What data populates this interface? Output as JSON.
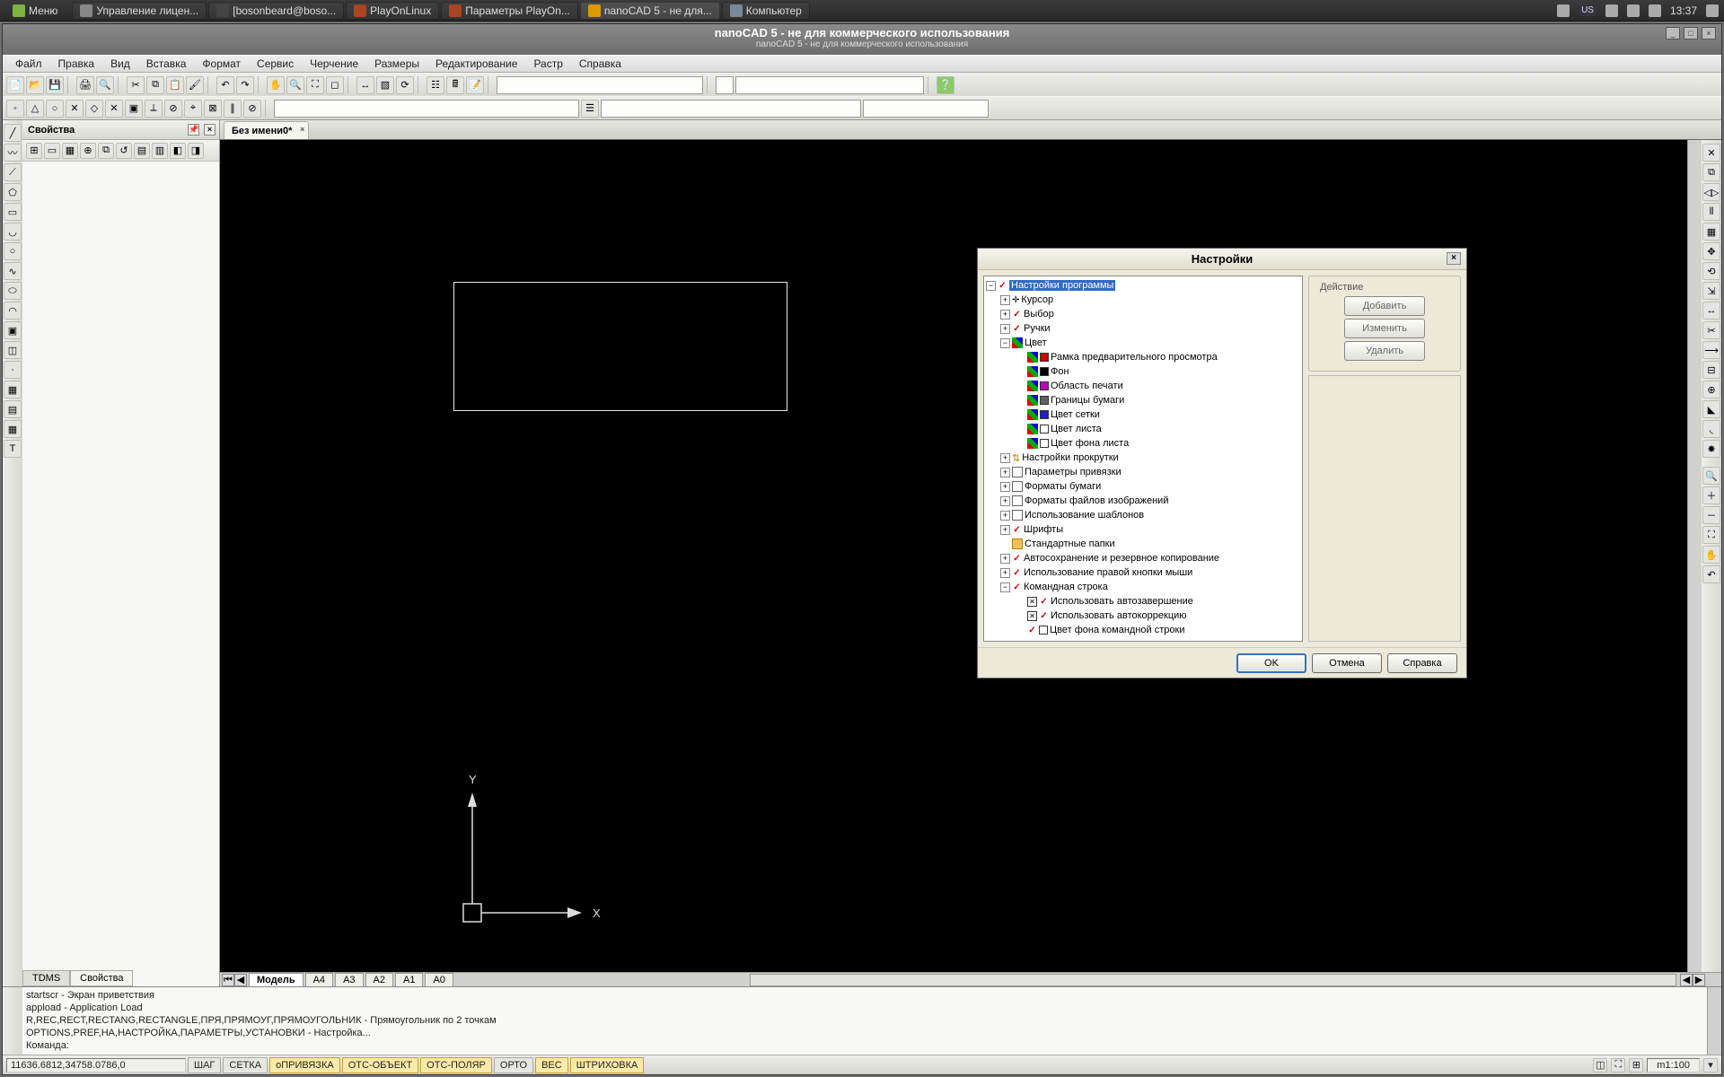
{
  "os": {
    "menu": "Меню",
    "tasks": [
      {
        "label": "Управление лицен..."
      },
      {
        "label": "[bosonbeard@boso..."
      },
      {
        "label": "PlayOnLinux"
      },
      {
        "label": "Параметры PlayOn..."
      },
      {
        "label": "nanoCAD 5 - не для...",
        "active": true
      },
      {
        "label": "Компьютер"
      }
    ],
    "lang": "US",
    "time": "13:37"
  },
  "window": {
    "title": "nanoCAD 5 - не для коммерческого использования",
    "subtitle": "nanoCAD 5 - не для коммерческого использования"
  },
  "menu": [
    "Файл",
    "Правка",
    "Вид",
    "Вставка",
    "Формат",
    "Сервис",
    "Черчение",
    "Размеры",
    "Редактирование",
    "Растр",
    "Справка"
  ],
  "properties_panel": {
    "title": "Свойства"
  },
  "file_tabs": {
    "items": [
      {
        "label": "Без имени0*"
      }
    ]
  },
  "sheet_tabs": [
    "Модель",
    "A4",
    "A3",
    "A2",
    "A1",
    "A0"
  ],
  "dock_tabs": [
    "TDMS",
    "Свойства"
  ],
  "dock_active": 1,
  "ucs": {
    "x": "X",
    "y": "Y"
  },
  "command": {
    "lines": [
      "startscr - Экран приветствия",
      "appload - Application Load",
      "R,REC,RECT,RECTANG,RECTANGLE,ПРЯ,ПРЯМОУГ,ПРЯМОУГОЛЬНИК - Прямоугольник по 2 точкам",
      "OPTIONS,PREF,НА,НАСТРОЙКА,ПАРАМЕТРЫ,УСТАНОВКИ - Настройка..."
    ],
    "prompt": "Команда:"
  },
  "status": {
    "coord": "11636.6812,34758.0786,0",
    "buttons": [
      {
        "label": "ШАГ",
        "on": false
      },
      {
        "label": "СЕТКА",
        "on": false
      },
      {
        "label": "оПРИВЯЗКА",
        "on": true
      },
      {
        "label": "ОТС-ОБЪЕКТ",
        "on": true
      },
      {
        "label": "ОТС-ПОЛЯР",
        "on": true
      },
      {
        "label": "ОРТО",
        "on": false
      },
      {
        "label": "ВЕС",
        "on": true
      },
      {
        "label": "ШТРИХОВКА",
        "on": true
      }
    ],
    "scale": "m1:100"
  },
  "dialog": {
    "title": "Настройки",
    "actions_group": "Действие",
    "btn_add": "Добавить",
    "btn_edit": "Изменить",
    "btn_delete": "Удалить",
    "btn_ok": "OK",
    "btn_cancel": "Отмена",
    "btn_help": "Справка",
    "tree": {
      "root": "Настройки программы",
      "cursor": "Курсор",
      "selection": "Выбор",
      "grips": "Ручки",
      "color": "Цвет",
      "color_items": [
        {
          "label": "Рамка предварительного просмотра",
          "box": "#d00000"
        },
        {
          "label": "Фон",
          "box": "#000000"
        },
        {
          "label": "Область печати",
          "box": "#c000c0"
        },
        {
          "label": "Границы бумаги",
          "box": "#606060"
        },
        {
          "label": "Цвет сетки",
          "box": "#2020c0"
        },
        {
          "label": "Цвет листа",
          "box": "#ffffff"
        },
        {
          "label": "Цвет фона листа",
          "box": "#ffffff"
        }
      ],
      "scroll": "Настройки прокрутки",
      "snap": "Параметры привязки",
      "paper_formats": "Форматы бумаги",
      "image_formats": "Форматы файлов изображений",
      "templates": "Использование шаблонов",
      "fonts": "Шрифты",
      "std_folders": "Стандартные папки",
      "autosave": "Автосохранение и резервное копирование",
      "rmb": "Использование правой кнопки мыши",
      "cmdline": "Командная строка",
      "cmd_auto": "Использовать автозавершение",
      "cmd_corr": "Использовать автокоррекцию",
      "cmd_color": "Цвет фона командной строки"
    }
  }
}
